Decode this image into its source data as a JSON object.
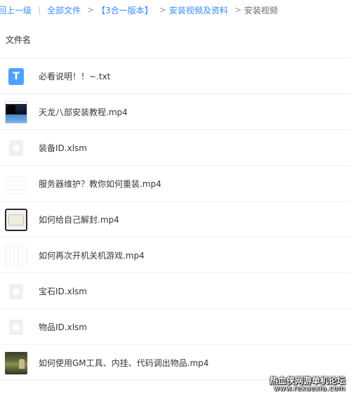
{
  "breadcrumb": {
    "back": "回上一级",
    "separator": "|",
    "all_files": "全部文件",
    "items": [
      "【3合一版本】",
      "安装视频及资料"
    ],
    "current": "安装视频",
    "arrow": ">"
  },
  "columns": {
    "name": "文件名"
  },
  "files": [
    {
      "name": "必看说明！！~.txt",
      "icon": "txt-file-icon",
      "icon_letter": "T"
    },
    {
      "name": "天龙八部安装教程.mp4",
      "icon": "video-thumbnail"
    },
    {
      "name": "装备ID.xlsm",
      "icon": "generic-file-icon"
    },
    {
      "name": "服务器维护？教你如何重装.mp4",
      "icon": "video-thumbnail"
    },
    {
      "name": "如何给自己解封.mp4",
      "icon": "video-thumbnail"
    },
    {
      "name": "如何再次开机关机游戏.mp4",
      "icon": "video-thumbnail"
    },
    {
      "name": "宝石ID.xlsm",
      "icon": "generic-file-icon"
    },
    {
      "name": "物品ID.xlsm",
      "icon": "generic-file-icon"
    },
    {
      "name": "如何使用GM工具、内挂、代码调出物品.mp4",
      "icon": "video-thumbnail"
    }
  ],
  "watermark": {
    "title": "热血侠网游单机论坛",
    "url": "www.rexuexia.com"
  },
  "colors": {
    "link": "#3b8cff",
    "txt_icon": "#4da3ff",
    "text": "#333840",
    "divider": "#eef0f2"
  }
}
